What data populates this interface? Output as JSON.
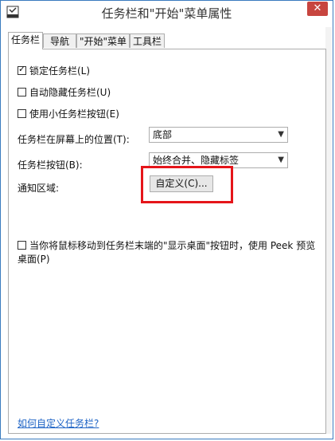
{
  "window": {
    "title": "任务栏和\"开始\"菜单属性",
    "close_symbol": "✕",
    "icons": [
      "taskbar-app-icon",
      "close-icon"
    ]
  },
  "tabs": [
    "任务栏",
    "导航",
    "\"开始\"菜单",
    "工具栏"
  ],
  "active_tab": 0,
  "options": [
    {
      "label": "锁定任务栏(L)",
      "checked": true
    },
    {
      "label": "自动隐藏任务栏(U)",
      "checked": false
    },
    {
      "label": "使用小任务栏按钮(E)",
      "checked": false
    }
  ],
  "position": {
    "label": "任务栏在屏幕上的位置(T):",
    "value": "底部"
  },
  "buttons": {
    "label": "任务栏按钮(B):",
    "value": "始终合并、隐藏标签"
  },
  "notify": {
    "label": "通知区域:",
    "button": "自定义(C)..."
  },
  "peek": {
    "label": "当你将鼠标移动到任务栏末端的\"显示桌面\"按钮时，使用 Peek 预览桌面(P)",
    "checked": false
  },
  "link": {
    "label": "如何自定义任务栏?"
  },
  "colors": {
    "highlight": "#e5151a",
    "link": "#1e63c5",
    "close": "#c7453f"
  }
}
